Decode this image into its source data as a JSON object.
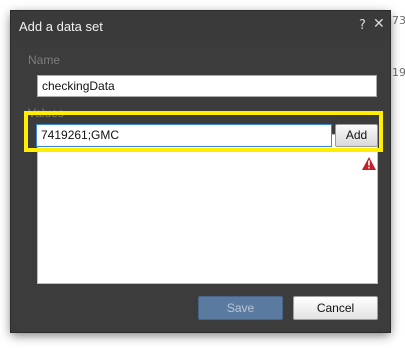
{
  "background": {
    "peek_text_1": "73",
    "peek_text_2": "19"
  },
  "dialog": {
    "title": "Add a data set",
    "help_label": "?",
    "close_label": "✕",
    "name_label": "Name",
    "name_value": "checkingData",
    "values_label": "Values",
    "value_input": "7419261;GMC",
    "add_label": "Add",
    "save_label": "Save",
    "cancel_label": "Cancel"
  },
  "icons": {
    "warning": "warning-icon",
    "help": "help-icon",
    "close": "close-icon"
  },
  "colors": {
    "dialog_bg": "#3c3c3c",
    "highlight": "#ffee00",
    "warning": "#c4202b",
    "save_disabled": "#5a7aa0"
  }
}
